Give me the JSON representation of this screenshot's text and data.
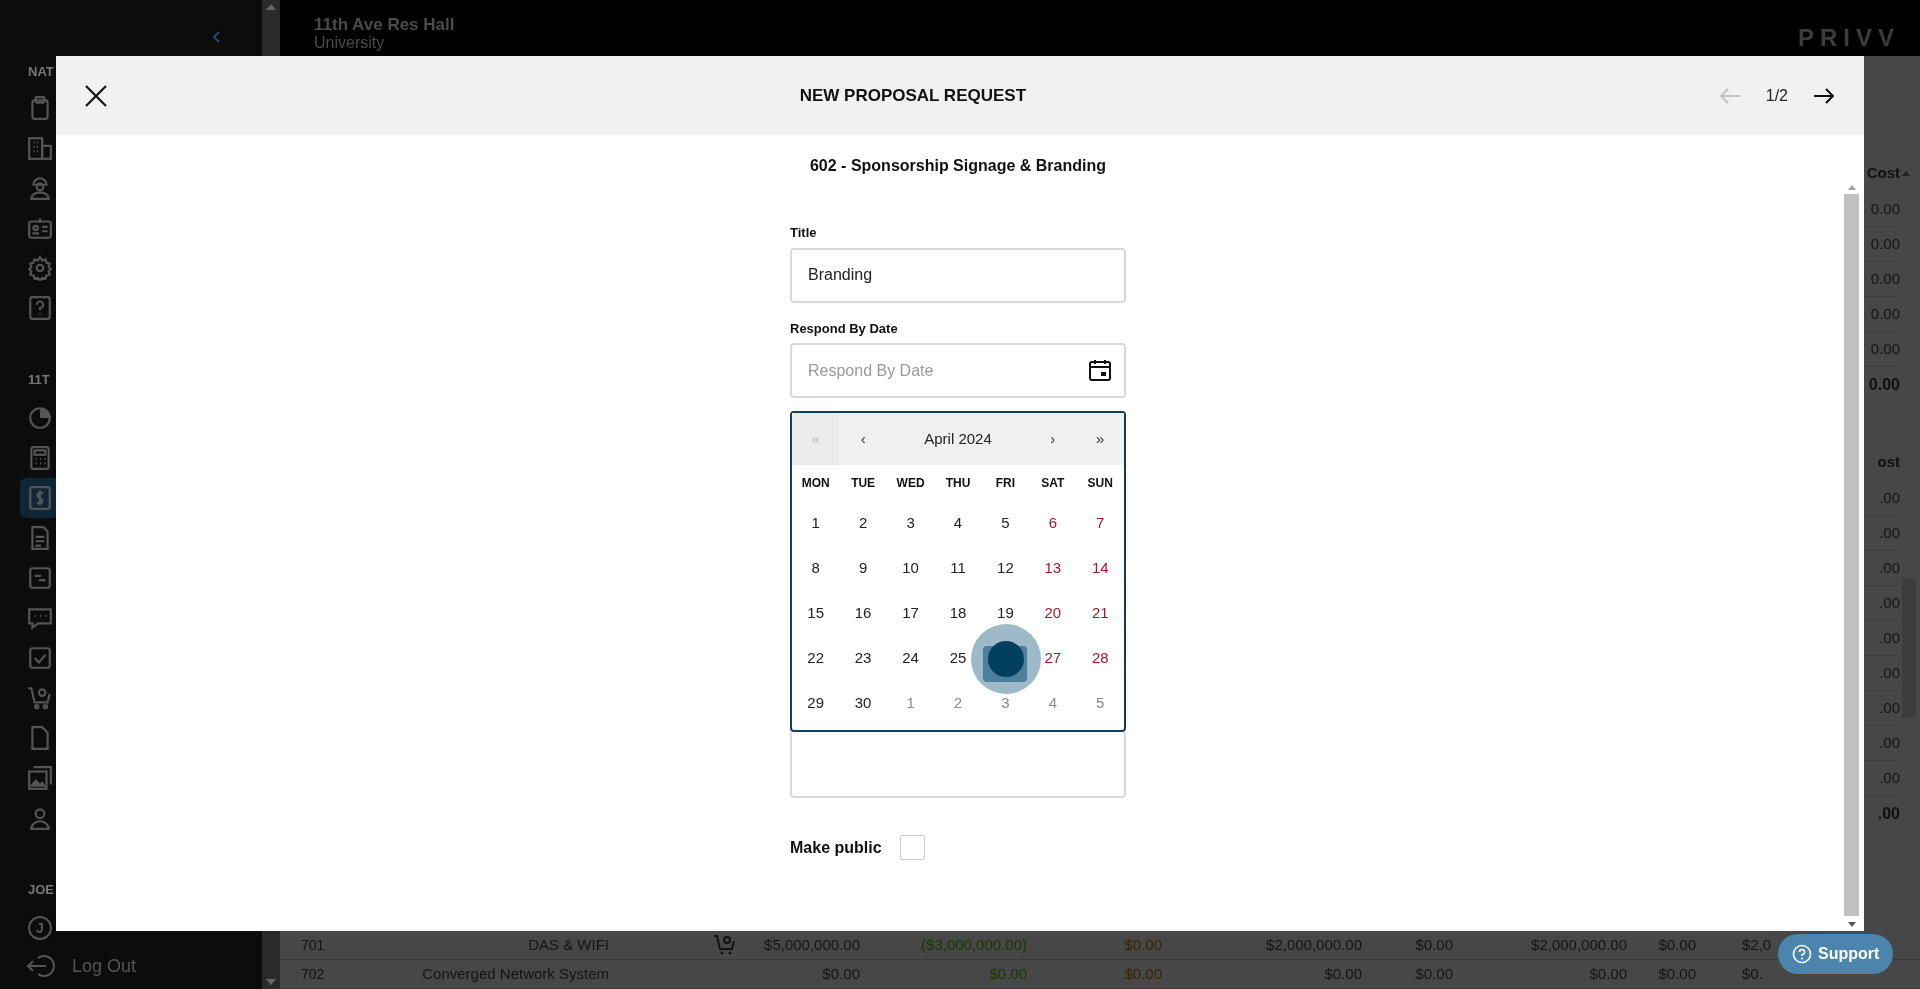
{
  "top_bar": {
    "project": "11th Ave Res Hall",
    "subtitle": "University",
    "logo": "PRIVV"
  },
  "sidebar": {
    "groups": [
      {
        "label": "NAT",
        "items": [
          {
            "selected": false
          },
          {
            "selected": false
          },
          {
            "selected": false
          },
          {
            "selected": false
          },
          {
            "selected": false
          },
          {
            "selected": false
          }
        ]
      },
      {
        "label": "11T",
        "items": [
          {
            "selected": false
          },
          {
            "selected": false
          },
          {
            "selected": true
          },
          {
            "selected": false
          },
          {
            "selected": false
          },
          {
            "selected": false
          },
          {
            "selected": false
          },
          {
            "selected": false
          },
          {
            "selected": false
          },
          {
            "selected": false
          },
          {
            "selected": false
          }
        ]
      },
      {
        "label": "JOE",
        "items": [
          {
            "selected": false
          }
        ]
      }
    ],
    "user_initial": "J",
    "logout": "Log Out"
  },
  "table": {
    "right_column": [
      {
        "text": "Cost",
        "kind": "header"
      },
      {
        "text": "0.00",
        "kind": "cell"
      },
      {
        "text": "0.00",
        "kind": "cell"
      },
      {
        "text": "0.00",
        "kind": "cell"
      },
      {
        "text": "0.00",
        "kind": "cell"
      },
      {
        "text": "0.00",
        "kind": "cell"
      },
      {
        "text": "0.00",
        "kind": "total"
      },
      {
        "text": "ost",
        "kind": "header"
      },
      {
        "text": ".00",
        "kind": "cell"
      },
      {
        "text": ".00",
        "kind": "cell"
      },
      {
        "text": ".00",
        "kind": "cell"
      },
      {
        "text": ".00",
        "kind": "cell"
      },
      {
        "text": ".00",
        "kind": "cell"
      },
      {
        "text": ".00",
        "kind": "cell"
      },
      {
        "text": ".00",
        "kind": "cell"
      },
      {
        "text": ".00",
        "kind": "cell"
      },
      {
        "text": ".00",
        "kind": "cell"
      },
      {
        "text": ".00",
        "kind": "total"
      }
    ],
    "rows": [
      {
        "code": "701",
        "name": "DAS & WIFI",
        "cart": true,
        "values": [
          "$5,000,000.00",
          "($3,000,000.00)",
          "$0.00",
          "$2,000,000.00",
          "$0.00",
          "$2,000,000.00",
          "$0.00",
          "$2,0"
        ]
      },
      {
        "code": "702",
        "name": "Converged Network System",
        "cart": false,
        "values": [
          "$0.00",
          "$0.00",
          "$0.00",
          "$0.00",
          "$0.00",
          "$0.00",
          "$0.00",
          "$0."
        ]
      }
    ]
  },
  "support_button": "Support",
  "modal": {
    "title": "NEW PROPOSAL REQUEST",
    "pager": "1/2",
    "subtitle": "602 - Sponsorship Signage & Branding",
    "title_field": {
      "label": "Title",
      "value": "Branding"
    },
    "date_field": {
      "label": "Respond By Date",
      "placeholder": "Respond By Date"
    },
    "calendar": {
      "first": "«",
      "prev": "‹",
      "month": "April 2024",
      "next": "›",
      "last": "»",
      "weekdays": [
        "MON",
        "TUE",
        "WED",
        "THU",
        "FRI",
        "SAT",
        "SUN"
      ],
      "days": [
        {
          "label": "1",
          "kind": "day"
        },
        {
          "label": "2",
          "kind": "day"
        },
        {
          "label": "3",
          "kind": "day"
        },
        {
          "label": "4",
          "kind": "day"
        },
        {
          "label": "5",
          "kind": "day"
        },
        {
          "label": "6",
          "kind": "weekend"
        },
        {
          "label": "7",
          "kind": "weekend"
        },
        {
          "label": "8",
          "kind": "day"
        },
        {
          "label": "9",
          "kind": "day"
        },
        {
          "label": "10",
          "kind": "day"
        },
        {
          "label": "11",
          "kind": "day"
        },
        {
          "label": "12",
          "kind": "day"
        },
        {
          "label": "13",
          "kind": "weekend"
        },
        {
          "label": "14",
          "kind": "weekend"
        },
        {
          "label": "15",
          "kind": "day"
        },
        {
          "label": "16",
          "kind": "day"
        },
        {
          "label": "17",
          "kind": "day"
        },
        {
          "label": "18",
          "kind": "day"
        },
        {
          "label": "19",
          "kind": "day"
        },
        {
          "label": "20",
          "kind": "weekend"
        },
        {
          "label": "21",
          "kind": "weekend"
        },
        {
          "label": "22",
          "kind": "day"
        },
        {
          "label": "23",
          "kind": "day"
        },
        {
          "label": "24",
          "kind": "day"
        },
        {
          "label": "25",
          "kind": "day"
        },
        {
          "kind": "selected"
        },
        {
          "label": "27",
          "kind": "weekend"
        },
        {
          "label": "28",
          "kind": "weekend"
        },
        {
          "label": "29",
          "kind": "day"
        },
        {
          "label": "30",
          "kind": "day"
        },
        {
          "label": "1",
          "kind": "other"
        },
        {
          "label": "2",
          "kind": "other"
        },
        {
          "label": "3",
          "kind": "other"
        },
        {
          "label": "4",
          "kind": "other"
        },
        {
          "label": "5",
          "kind": "other"
        }
      ]
    },
    "make_public": {
      "label": "Make public",
      "checked": false
    }
  }
}
